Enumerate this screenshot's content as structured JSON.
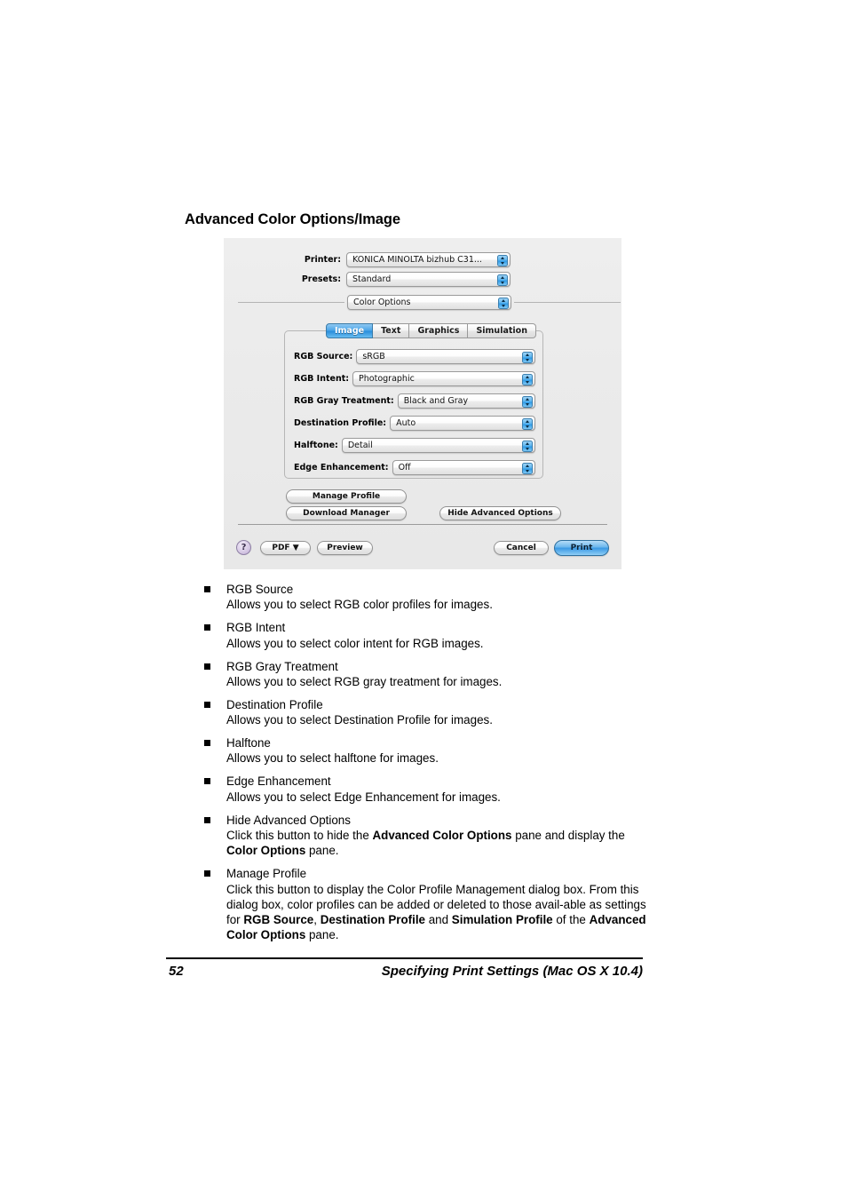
{
  "page": {
    "heading": "Advanced Color Options/Image"
  },
  "dialog": {
    "printer_label": "Printer:",
    "printer_value": "KONICA MINOLTA bizhub C31...",
    "presets_label": "Presets:",
    "presets_value": "Standard",
    "pane_value": "Color Options",
    "tabs": [
      {
        "label": "Image",
        "selected": true
      },
      {
        "label": "Text",
        "selected": false
      },
      {
        "label": "Graphics",
        "selected": false
      },
      {
        "label": "Simulation",
        "selected": false
      }
    ],
    "options": [
      {
        "label": "RGB Source:",
        "value": "sRGB"
      },
      {
        "label": "RGB Intent:",
        "value": "Photographic"
      },
      {
        "label": "RGB Gray Treatment:",
        "value": "Black and Gray"
      },
      {
        "label": "Destination Profile:",
        "value": "Auto"
      },
      {
        "label": "Halftone:",
        "value": "Detail"
      },
      {
        "label": "Edge Enhancement:",
        "value": "Off"
      }
    ],
    "buttons": {
      "manage_profile": "Manage Profile",
      "download_manager": "Download Manager",
      "hide_advanced_options": "Hide Advanced Options",
      "help": "?",
      "pdf": "PDF ▼",
      "preview": "Preview",
      "cancel": "Cancel",
      "print": "Print"
    },
    "colors": {
      "accent_blue": "#3b9ae4",
      "dialog_background": "#ebebeb",
      "help_purple": "#bdaad2"
    }
  },
  "bullets": [
    {
      "term": "RGB Source",
      "desc_html": "Allows you to select RGB color profiles for images."
    },
    {
      "term": "RGB Intent",
      "desc_html": "Allows you to select color intent for RGB images."
    },
    {
      "term": "RGB Gray Treatment",
      "desc_html": "Allows you to select RGB gray treatment for images."
    },
    {
      "term": "Destination Profile",
      "desc_html": "Allows you to select Destination Profile for images."
    },
    {
      "term": "Halftone",
      "desc_html": "Allows you to select halftone for images."
    },
    {
      "term": "Edge Enhancement",
      "desc_html": "Allows you to select Edge Enhancement for images."
    },
    {
      "term": "Hide Advanced Options",
      "desc_html": "Click this button to hide the <b>Advanced Color Options</b> pane and display the <b>Color Options</b> pane."
    },
    {
      "term": "Manage Profile",
      "desc_html": "Click this button to display the Color Profile Management dialog box. From this dialog box, color profiles can be added or deleted to those avail-able as settings for <b>RGB Source</b>, <b>Destination Profile</b> and <b>Simulation Profile</b> of the <b>Advanced Color Options</b> pane."
    }
  ],
  "footer": {
    "page_number": "52",
    "title": "Specifying Print Settings (Mac OS X 10.4)"
  }
}
